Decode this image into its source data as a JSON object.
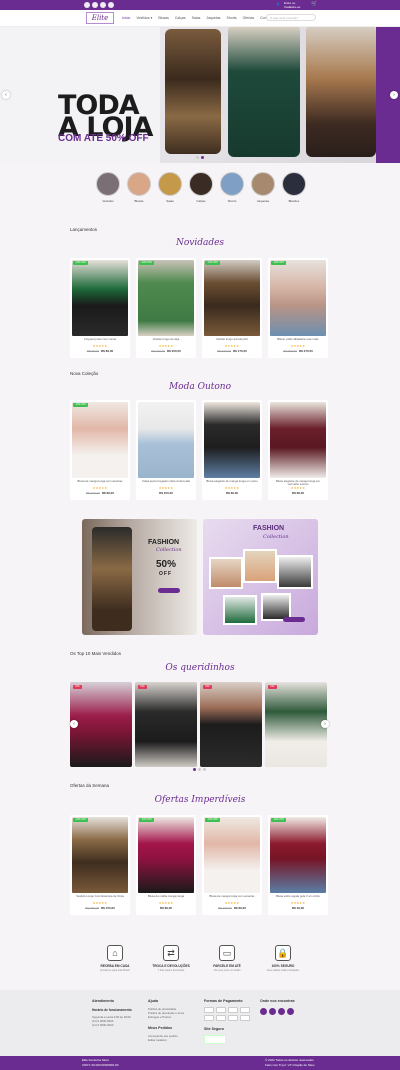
{
  "topbar": {
    "right_text": "Entre ou",
    "right_text2": "Cadastre-se"
  },
  "header": {
    "logo": "Elite",
    "nav": [
      "Início",
      "Vestidos ▾",
      "Blusas",
      "Calças",
      "Saias",
      "Jaquetas",
      "Shorts",
      "Ofertas",
      "Contato"
    ],
    "search_placeholder": "O que você procura?"
  },
  "hero": {
    "title": "TODA A LOJA",
    "subtitle": "COM ATÉ 50% OFF"
  },
  "categories": [
    "Vestidos",
    "Blusas",
    "Saias",
    "Calças",
    "Shorts",
    "Jaquetas",
    "Blusões"
  ],
  "sections": {
    "launches": {
      "label": "Lançamentos",
      "script": "Novidades"
    },
    "new_collection": {
      "label": "Nova Coleção",
      "script": "Moda Outono"
    },
    "top10": {
      "label": "Os Top 10 Mais Vendidos",
      "script": "Os queridinhos"
    },
    "offers": {
      "label": "Ofertas da Semana",
      "script": "Ofertas Imperdíveis"
    }
  },
  "launches": [
    {
      "badge": "-10% OFF",
      "name": "Cropped preto com corset",
      "stars": "★★★★★",
      "old": "R$ 99,00",
      "price": "R$ 89,00"
    },
    {
      "badge": "-10% OFF",
      "name": "Vestido longo de alça",
      "stars": "★★★★★",
      "old": "R$ 220,00",
      "price": "R$ 200,00"
    },
    {
      "badge": "-10% OFF",
      "name": "Vestido longo animal print",
      "stars": "★★★★★",
      "old": "R$ 190,00",
      "price": "R$ 170,00"
    },
    {
      "badge": "-10% OFF",
      "name": "Blazer estilo alfaiataria rosé nude",
      "stars": "★★★★★",
      "old": "R$ 250,00",
      "price": "R$ 270,00"
    }
  ],
  "autumn": [
    {
      "badge": "-10% OFF",
      "name": "Blusa de manga longa com amarras",
      "stars": "★★★★★",
      "old": "R$ 109,00",
      "price": "R$ 89,00"
    },
    {
      "badge": "",
      "name": "Calça jeans boyjeans clara cintura alta",
      "stars": "★★★★★",
      "old": "",
      "price": "R$ 150,00"
    },
    {
      "badge": "",
      "name": "Blusa elegante de manga longa em preto",
      "stars": "★★★★★",
      "old": "",
      "price": "R$ 69,00"
    },
    {
      "badge": "",
      "name": "Blusa elegante de manga longa em vermelho escuro",
      "stars": "★★★★★",
      "old": "",
      "price": "R$ 89,00"
    }
  ],
  "banners": {
    "b1_title": "FASHION",
    "b1_sub": "Collection",
    "b1_off": "50%",
    "b1_off2": "OFF",
    "b2_title": "FASHION",
    "b2_sub": "Collection"
  },
  "offers": [
    {
      "badge": "-10% OFF",
      "name": "Vestido Longo Com Estampa de Onça",
      "stars": "★★★★★",
      "old": "R$ 299,00",
      "price": "R$ 150,00"
    },
    {
      "badge": "-10% OFF",
      "name": "Blusa de malha manga longa",
      "stars": "★★★★★",
      "old": "",
      "price": "R$ 89,00"
    },
    {
      "badge": "-10% OFF",
      "name": "Blusa de manga longa com amarras",
      "stars": "★★★★★",
      "old": "R$ 109,00",
      "price": "R$ 89,00"
    },
    {
      "badge": "-10% OFF",
      "name": "Blusa estilo regata gola V em vinho",
      "stars": "★★★★★",
      "old": "",
      "price": "R$ 49,00"
    }
  ],
  "features": [
    {
      "icon": "⌂",
      "title": "RECEBA EM CASA",
      "text": "Enviamos para todo Brasil"
    },
    {
      "icon": "⇄",
      "title": "TROCA E DEVOLUÇÕES",
      "text": "7 dias para a devolução"
    },
    {
      "icon": "▭",
      "title": "PARCELE EM ATÉ",
      "text": "10x sem juros no cartão"
    },
    {
      "icon": "🔒",
      "title": "100% SEGURO",
      "text": "Seus dados estão protegidos"
    }
  ],
  "footer": {
    "col1_title": "Atendimento",
    "col1_sub": "Horário de funcionamento",
    "col1_lines": [
      "Segunda a sexta 9:00 às 18:00",
      "(11) 9 0000-0000",
      "(11) 9 0000-0000"
    ],
    "col2_title": "Ajuda",
    "col2_lines": [
      "Política de privacidade",
      "Política de devolução e troca",
      "Entregas e Prazos"
    ],
    "col2_title2": "Meus Pedidos",
    "col2_lines2": [
      "Acompanhe seu pedido",
      "Editar cadastro"
    ],
    "col3_title": "Formas de Pagamento",
    "col3_title2": "Site Seguro",
    "col4_title": "Onde nos encontrar:"
  },
  "bottom": {
    "left1": "Elite Feminina Store",
    "left2": "CNPJ: 00.000.000/0000-00",
    "right1": "© 2022 Todos os direitos reservados",
    "right2": "Feito com ♥ por: VX Criação de Sites"
  }
}
